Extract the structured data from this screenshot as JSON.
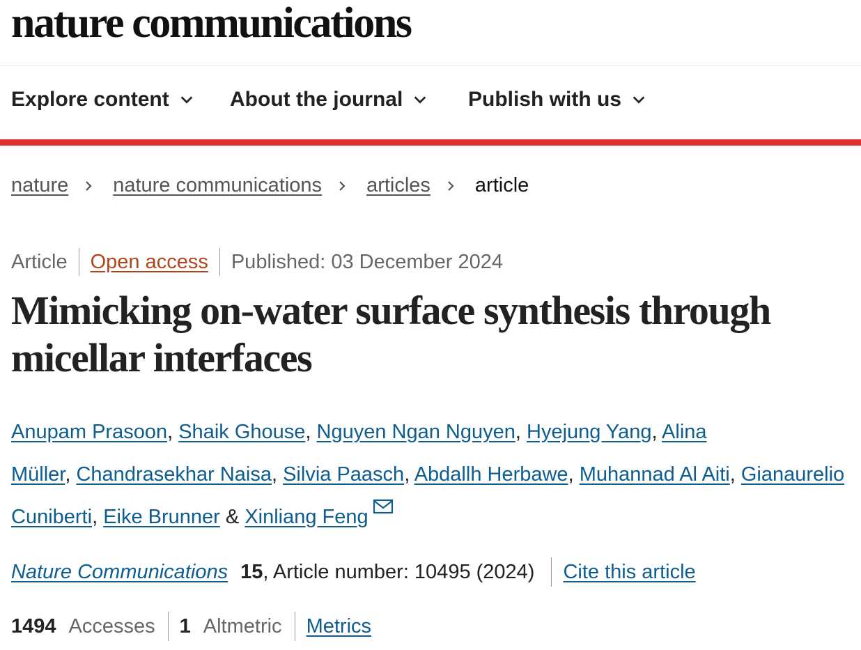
{
  "header": {
    "brand": "nature communications"
  },
  "nav": {
    "items": [
      {
        "label": "Explore content"
      },
      {
        "label": "About the journal"
      },
      {
        "label": "Publish with us"
      }
    ],
    "accent_color": "#e0312e"
  },
  "breadcrumb": {
    "items": [
      "nature",
      "nature communications",
      "articles"
    ],
    "current": "article"
  },
  "article": {
    "type": "Article",
    "access": "Open access",
    "published": "Published: 03 December 2024",
    "title": "Mimicking on-water surface synthesis through micellar interfaces",
    "authors": [
      "Anupam Prasoon",
      "Shaik Ghouse",
      "Nguyen Ngan Nguyen",
      "Hyejung Yang",
      "Alina Müller",
      "Chandrasekhar Naisa",
      "Silvia Paasch",
      "Abdallh Herbawe",
      "Muhannad Al Aiti",
      "Gianaurelio Cuniberti",
      "Eike Brunner",
      "Xinliang Feng"
    ],
    "author_separator": ", ",
    "author_last_join": " & ",
    "corresponding_icon": "mail-icon"
  },
  "citation": {
    "journal": "Nature Communications",
    "volume": "15",
    "article_number": ", Article number: 10495 (2024)",
    "cite_label": "Cite this article"
  },
  "metrics": {
    "accesses_count": "1494",
    "accesses_label": "Accesses",
    "altmetric_count": "1",
    "altmetric_label": "Altmetric",
    "metrics_link": "Metrics"
  },
  "colors": {
    "link": "#0f5d8f",
    "open_access": "#b3451e",
    "accent": "#e0312e"
  }
}
